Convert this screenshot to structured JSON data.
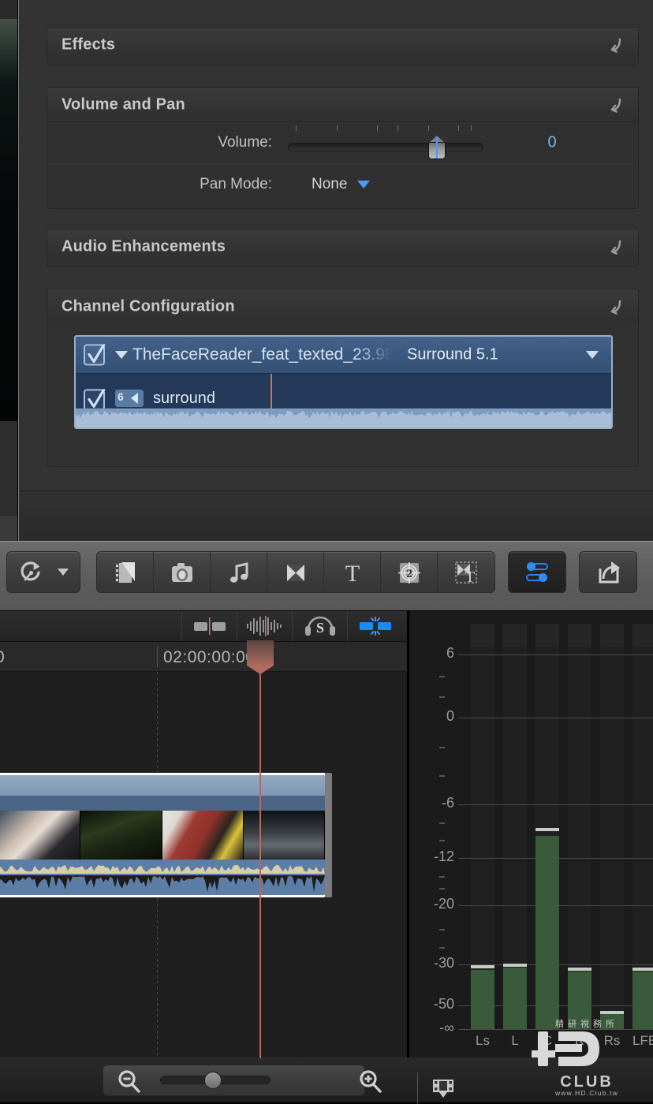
{
  "inspector": {
    "sections": [
      {
        "id": "effects",
        "title": "Effects",
        "reset_icon": "reset-arrow-icon"
      },
      {
        "id": "volume_and_pan",
        "title": "Volume and Pan",
        "reset_icon": "reset-arrow-icon"
      },
      {
        "id": "audio_enhancements",
        "title": "Audio Enhancements",
        "reset_icon": "reset-arrow-icon"
      },
      {
        "id": "channel_configuration",
        "title": "Channel Configuration",
        "reset_icon": "reset-arrow-icon"
      }
    ],
    "volume": {
      "label": "Volume:",
      "value": "0",
      "slider_position_pct": 72
    },
    "pan": {
      "label": "Pan Mode:",
      "value": "None",
      "caret_icon": "caret-down-icon"
    },
    "channel_config": {
      "component_checked": true,
      "component_name": "TheFaceReader_feat_texted_23.98",
      "layout": "Surround 5.1",
      "layout_caret_icon": "caret-down-icon",
      "disclosure_icon": "disclosure-triangle-icon",
      "channel": {
        "checked": true,
        "badge_count": "6",
        "badge_icon": "speaker-icon",
        "name": "surround"
      }
    }
  },
  "toolbar": {
    "retime": {
      "label": "Retime",
      "icon": "retime-speedometer-icon",
      "caret_icon": "caret-down-icon"
    },
    "media_group": [
      {
        "name": "media-browser",
        "icon": "filmstrip-photos-icon"
      },
      {
        "name": "photos-audio-browser",
        "icon": "camera-icon"
      },
      {
        "name": "music-browser",
        "icon": "music-note-icon"
      },
      {
        "name": "transitions-browser",
        "icon": "transition-bowtie-icon"
      },
      {
        "name": "titles-browser",
        "icon": "text-t-icon"
      },
      {
        "name": "generators-browser",
        "icon": "countdown-generator-icon"
      },
      {
        "name": "themes-browser",
        "icon": "theme-transition-text-icon"
      }
    ],
    "inspector_toggle": {
      "name": "inspector-toggle",
      "icon": "sliders-icon",
      "active": true
    },
    "share": {
      "name": "share-button",
      "icon": "share-export-icon"
    }
  },
  "timeline": {
    "tools": [
      {
        "name": "clip-skimming",
        "icon": "clip-skimming-icon",
        "active": false
      },
      {
        "name": "audio-skimming",
        "icon": "audio-skimming-icon",
        "active": false
      },
      {
        "name": "solo",
        "icon": "solo-headphones-icon",
        "active": false
      },
      {
        "name": "snapping",
        "icon": "snapping-magnet-icon",
        "active": true
      }
    ],
    "ruler": {
      "left_partial_timecode": "0",
      "timecode": "02:00:00:00"
    },
    "clip": {
      "name": "timeline-clip",
      "selected": true
    }
  },
  "meters": {
    "scale_labels": [
      "6",
      "0",
      "-6",
      "-12",
      "-20",
      "-30",
      "-50",
      "-∞"
    ],
    "channels": [
      "Ls",
      "L",
      "C",
      "R",
      "Rs",
      "LFE"
    ],
    "levels_db": [
      -32.5,
      -31.5,
      -9.5,
      -33.5,
      -57.5,
      -33.5
    ],
    "peaks_db": [
      -32.0,
      -31.0,
      -9.0,
      -33.0,
      -57.0,
      -33.0
    ]
  },
  "bottom_bar": {
    "zoom_out": {
      "name": "zoom-out-button",
      "icon": "magnifier-minus-icon"
    },
    "zoom_in": {
      "name": "zoom-in-button",
      "icon": "magnifier-plus-icon"
    },
    "zoom_slider_pct": 44,
    "clip_appearance": {
      "name": "clip-appearance-button",
      "icon": "filmstrip-appearance-icon"
    }
  },
  "watermark": {
    "line1": "HD",
    "line2": "CLUB",
    "line3": "www.HD.Club.tw",
    "cjk": "精研視務所"
  },
  "colors": {
    "accent_blue": "#4c9bf5",
    "value_blue": "#7fb4e8",
    "selection_blue": "#3b587e",
    "meter_green": "#3a5a3c",
    "playhead_red": "#b06a5f",
    "panel_bg": "#333333"
  }
}
